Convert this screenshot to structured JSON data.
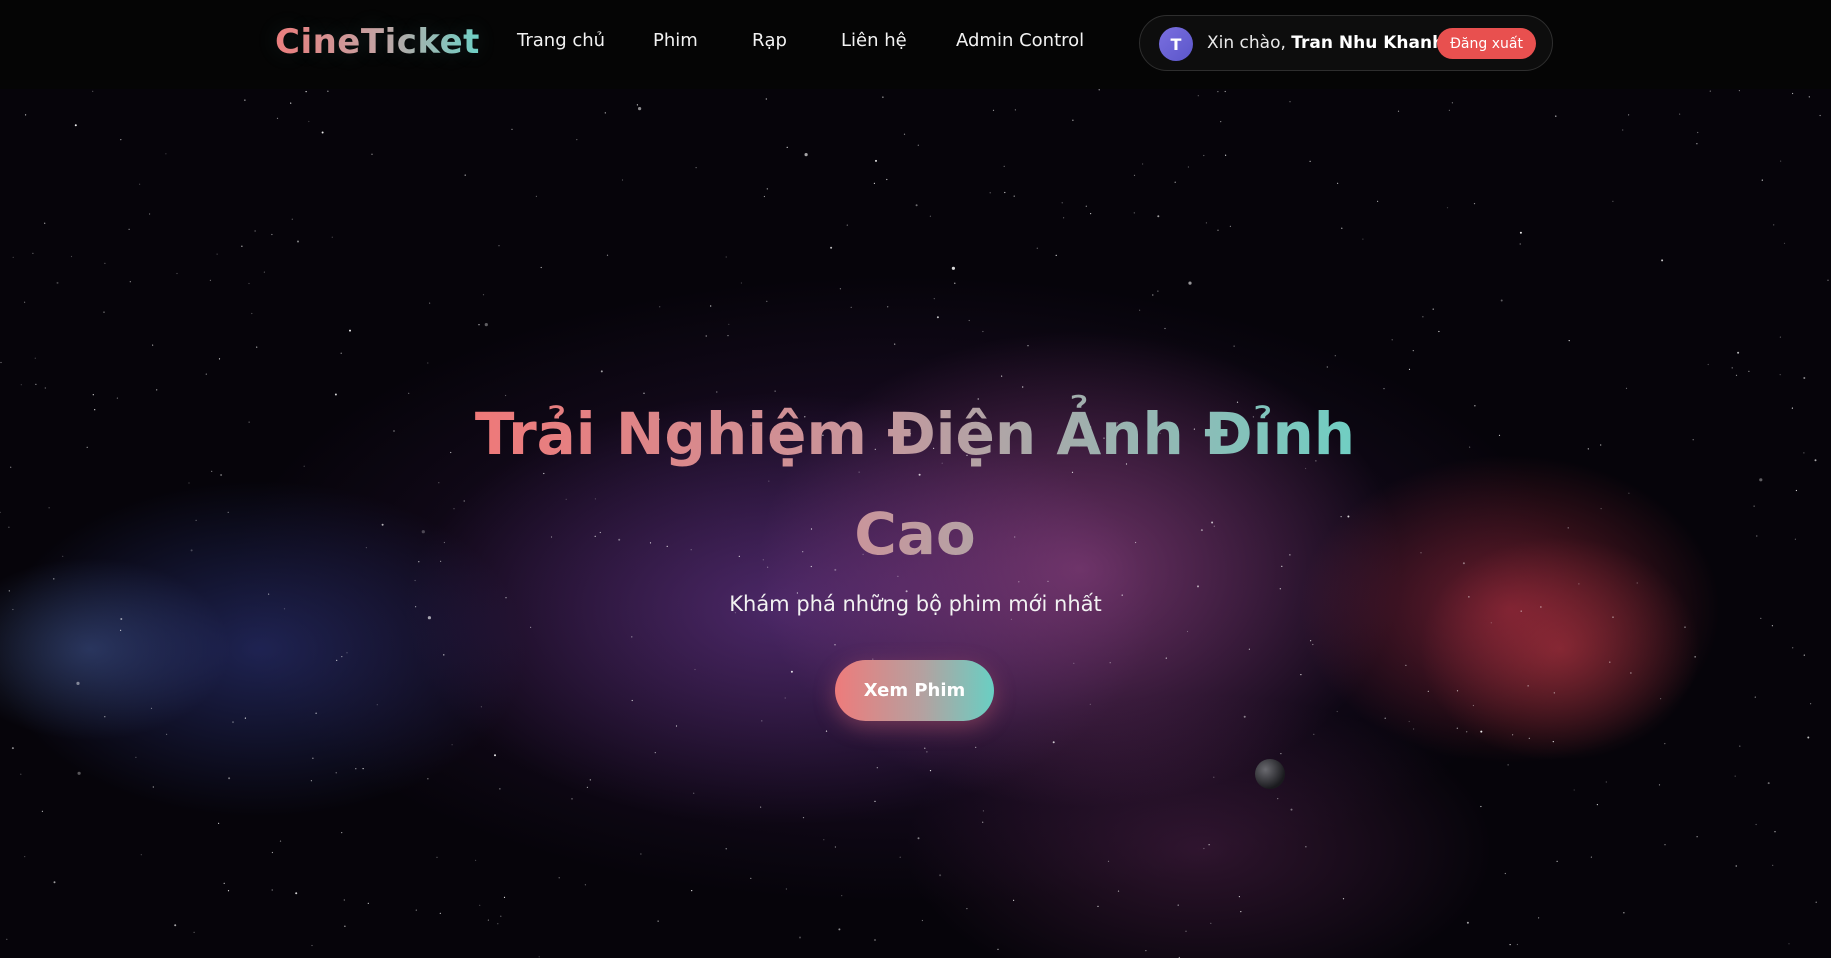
{
  "brand": {
    "logo_text": "CineTicket"
  },
  "nav": {
    "items": [
      {
        "label": "Trang chủ"
      },
      {
        "label": "Phim"
      },
      {
        "label": "Rạp"
      },
      {
        "label": "Liên hệ"
      },
      {
        "label": "Admin Control"
      }
    ]
  },
  "user": {
    "avatar_initial": "T",
    "greeting_prefix": "Xin chào, ",
    "name": "Tran Nhu Khanh",
    "logout_label": "Đăng xuất"
  },
  "hero": {
    "title": "Trải Nghiệm Điện Ảnh Đỉnh Cao",
    "subtitle": "Khám phá những bộ phim mới nhất",
    "cta_label": "Xem Phim"
  },
  "colors": {
    "gradient_start": "#f07878",
    "gradient_end": "#6ed0c4",
    "logout_bg": "#e8504f",
    "avatar_bg": "#6a63d6"
  }
}
